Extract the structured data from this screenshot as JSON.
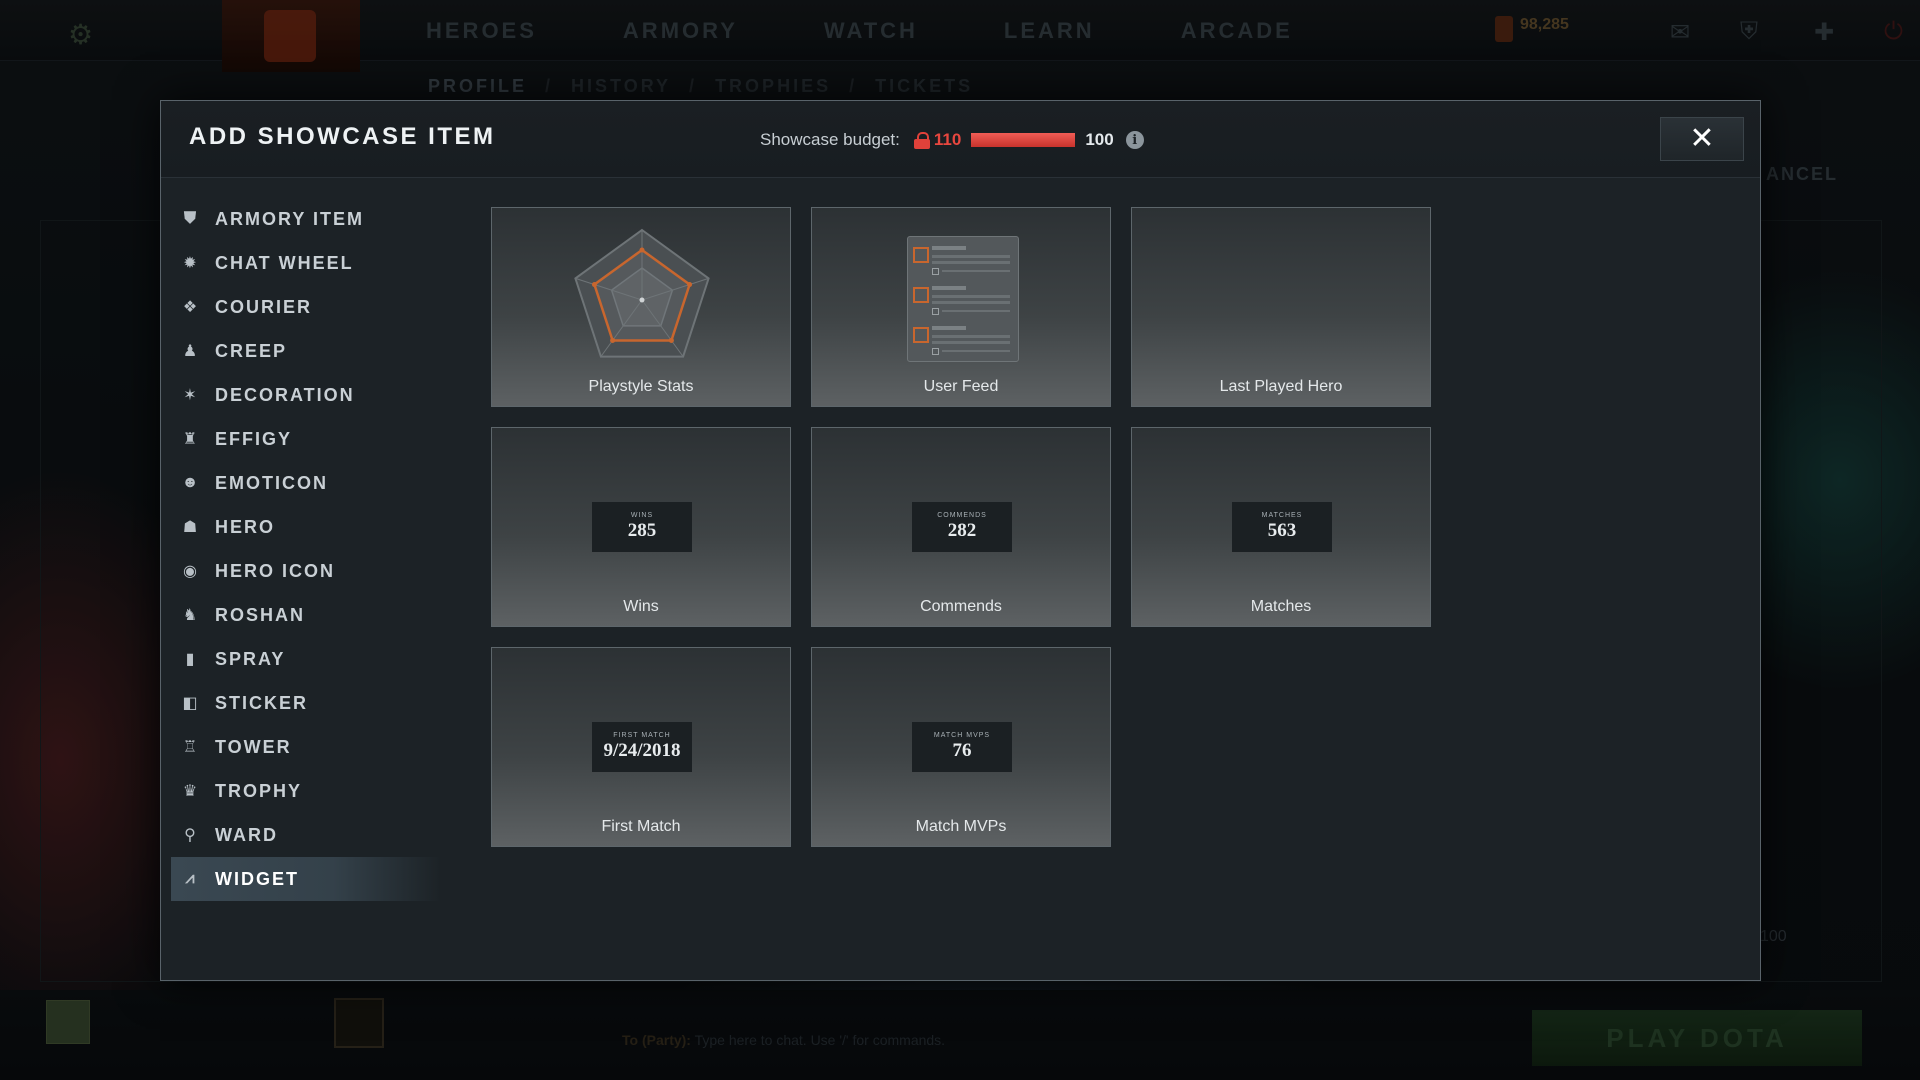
{
  "background": {
    "nav": [
      "HEROES",
      "ARMORY",
      "WATCH",
      "LEARN",
      "ARCADE"
    ],
    "subnav": [
      "PROFILE",
      "HISTORY",
      "TROPHIES",
      "TICKETS"
    ],
    "currency": "98,285",
    "cancel_label": "ANCEL",
    "budget_text": "100",
    "chat_party": "To (Party):",
    "chat_placeholder": "Type here to chat. Use '/' for commands.",
    "play_label": "PLAY DOTA"
  },
  "dialog": {
    "title": "ADD SHOWCASE ITEM",
    "budget": {
      "label": "Showcase budget:",
      "used": "110",
      "max": "100",
      "fill_fraction": 1.0,
      "info_glyph": "i"
    },
    "close_glyph": "✕"
  },
  "sidebar": {
    "items": [
      {
        "label": "ARMORY ITEM",
        "icon": "armory-icon"
      },
      {
        "label": "CHAT WHEEL",
        "icon": "chat-wheel-icon"
      },
      {
        "label": "COURIER",
        "icon": "courier-icon"
      },
      {
        "label": "CREEP",
        "icon": "creep-icon"
      },
      {
        "label": "DECORATION",
        "icon": "decoration-icon"
      },
      {
        "label": "EFFIGY",
        "icon": "effigy-icon"
      },
      {
        "label": "EMOTICON",
        "icon": "emoticon-icon"
      },
      {
        "label": "HERO",
        "icon": "hero-icon"
      },
      {
        "label": "HERO ICON",
        "icon": "hero-icon-icon"
      },
      {
        "label": "ROSHAN",
        "icon": "roshan-icon"
      },
      {
        "label": "SPRAY",
        "icon": "spray-icon"
      },
      {
        "label": "STICKER",
        "icon": "sticker-icon"
      },
      {
        "label": "TOWER",
        "icon": "tower-icon"
      },
      {
        "label": "TROPHY",
        "icon": "trophy-icon"
      },
      {
        "label": "WARD",
        "icon": "ward-icon"
      },
      {
        "label": "WIDGET",
        "icon": "widget-icon",
        "selected": true
      }
    ]
  },
  "widgets": [
    {
      "label": "Playstyle Stats",
      "kind": "radar"
    },
    {
      "label": "User Feed",
      "kind": "feed"
    },
    {
      "label": "Last Played Hero",
      "kind": "empty"
    },
    {
      "label": "Wins",
      "kind": "stat",
      "caption": "WINS",
      "value": "285"
    },
    {
      "label": "Commends",
      "kind": "stat",
      "caption": "COMMENDS",
      "value": "282"
    },
    {
      "label": "Matches",
      "kind": "stat",
      "caption": "MATCHES",
      "value": "563"
    },
    {
      "label": "First Match",
      "kind": "stat",
      "caption": "FIRST MATCH",
      "value": "9/24/2018"
    },
    {
      "label": "Match MVPs",
      "kind": "stat",
      "caption": "MATCH MVPS",
      "value": "76"
    }
  ],
  "colors": {
    "accent_red": "#e8473f",
    "radar_orange": "#c8662e",
    "selected_row": "#3a4852"
  }
}
